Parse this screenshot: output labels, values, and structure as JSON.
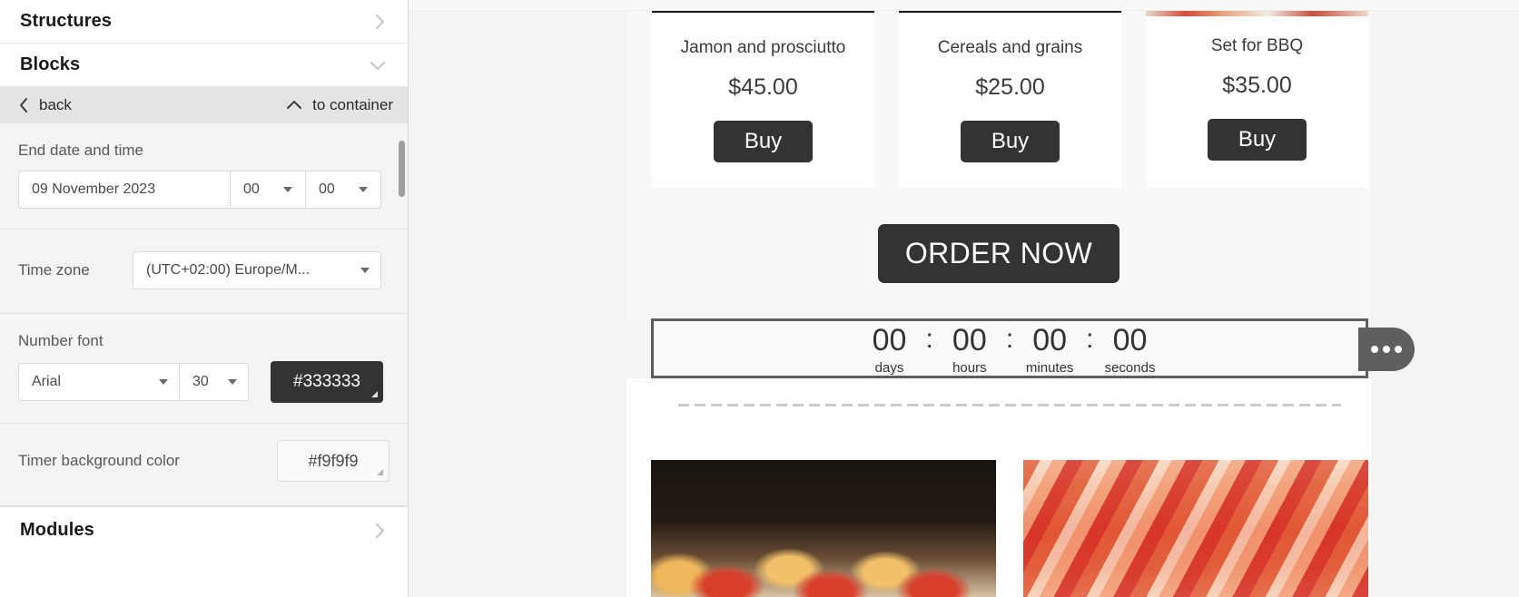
{
  "sidebar": {
    "sections": [
      {
        "title": "Structures",
        "chevron": "chevron-right-icon"
      },
      {
        "title": "Blocks",
        "chevron": "chevron-down-icon"
      },
      {
        "title": "Modules",
        "chevron": "chevron-right-icon"
      }
    ],
    "nav": {
      "back_label": "back",
      "back_icon": "chevron-left-icon",
      "to_container_label": "to container",
      "to_container_icon": "chevron-up-icon"
    },
    "end_date": {
      "label": "End date and time",
      "date_value": "09 November 2023",
      "hours_value": "00",
      "minutes_value": "00"
    },
    "time_zone": {
      "label": "Time zone",
      "value": "(UTC+02:00) Europe/M..."
    },
    "number_font": {
      "label": "Number font",
      "family_value": "Arial",
      "size_value": "30",
      "color_value": "#333333"
    },
    "timer_background": {
      "label": "Timer background color",
      "color_value": "#f9f9f9"
    }
  },
  "canvas": {
    "products": [
      {
        "title": "Jamon and prosciutto",
        "price": "$45.00",
        "buy_label": "Buy"
      },
      {
        "title": "Cereals and grains",
        "price": "$25.00",
        "buy_label": "Buy"
      },
      {
        "title": "Set for BBQ",
        "price": "$35.00",
        "buy_label": "Buy"
      }
    ],
    "order_button_label": "ORDER NOW",
    "timer": {
      "separator": ":",
      "cells": [
        {
          "value": "00",
          "label": "days"
        },
        {
          "value": "00",
          "label": "hours"
        },
        {
          "value": "00",
          "label": "minutes"
        },
        {
          "value": "00",
          "label": "seconds"
        }
      ]
    },
    "block_menu_icon": "ellipsis-icon"
  },
  "colors": {
    "accent_dark": "#333333",
    "timer_border": "#5f5f5f",
    "timer_bg": "#f9f9f9",
    "canvas_bg": "#f4f4f4"
  }
}
